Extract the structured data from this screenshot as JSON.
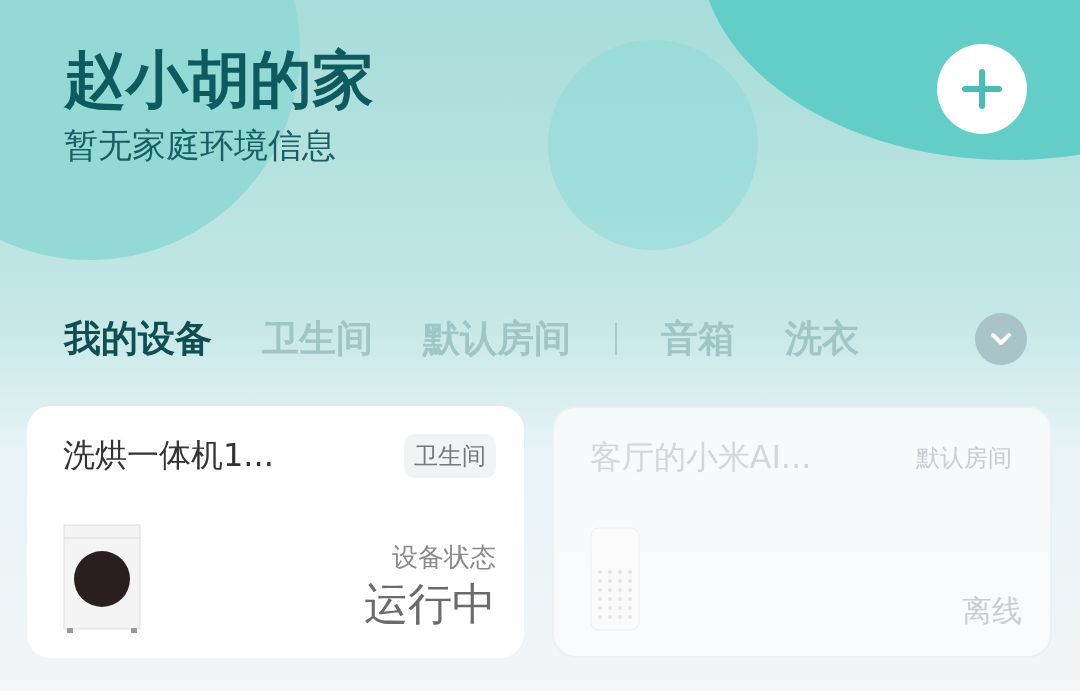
{
  "home": {
    "title": "赵小胡的家",
    "subtitle": "暂无家庭环境信息"
  },
  "tab_groups": [
    [
      {
        "label": "我的设备",
        "selected": true
      },
      {
        "label": "卫生间",
        "selected": false
      },
      {
        "label": "默认房间",
        "selected": false
      }
    ],
    [
      {
        "label": "音箱",
        "selected": false
      },
      {
        "label": "洗衣",
        "selected": false
      }
    ]
  ],
  "devices": [
    {
      "name": "洗烘一体机1...",
      "room": "卫生间",
      "kind": "washer",
      "online": true,
      "status_label": "设备状态",
      "status": "运行中"
    },
    {
      "name": "客厅的小米AI...",
      "room": "默认房间",
      "kind": "speaker",
      "online": false,
      "status": "离线"
    }
  ]
}
